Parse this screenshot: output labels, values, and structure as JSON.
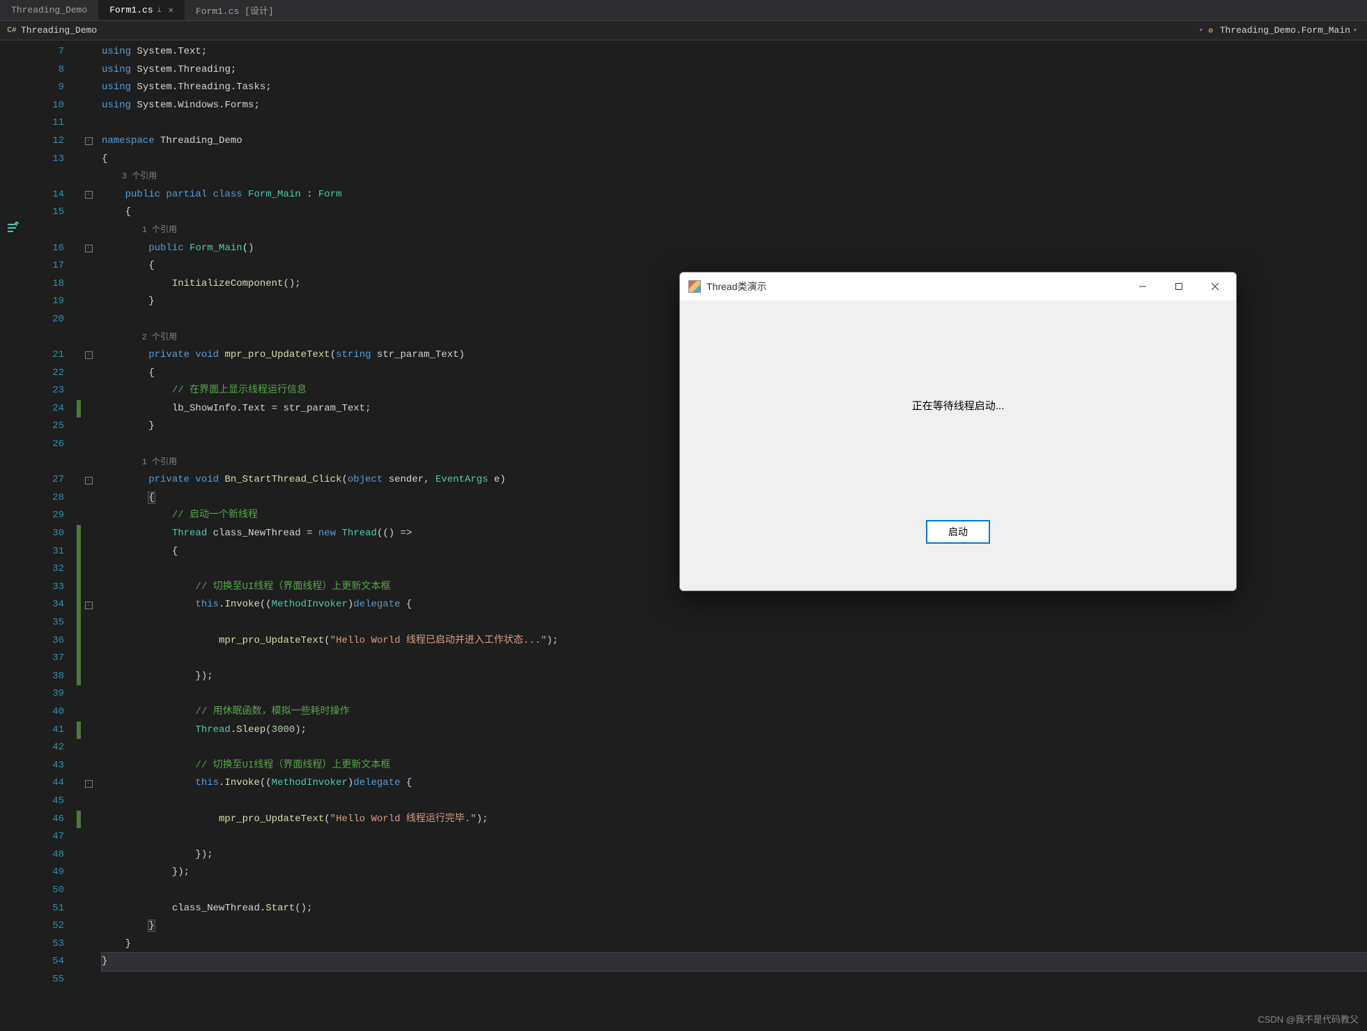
{
  "tabs": [
    {
      "label": "Threading_Demo",
      "active": false,
      "pinned": false,
      "closable": false
    },
    {
      "label": "Form1.cs",
      "active": true,
      "pinned": true,
      "closable": true
    },
    {
      "label": "Form1.cs [设计]",
      "active": false,
      "pinned": false,
      "closable": false
    }
  ],
  "breadcrumb": {
    "left_icon": "csharp-module-icon",
    "left": "Threading_Demo",
    "right_icon": "method-icon",
    "right": "Threading_Demo.Form_Main"
  },
  "line_numbers": [
    7,
    8,
    9,
    10,
    11,
    12,
    13,
    null,
    14,
    15,
    null,
    16,
    17,
    18,
    19,
    20,
    null,
    21,
    22,
    23,
    24,
    25,
    26,
    null,
    27,
    28,
    29,
    30,
    31,
    32,
    33,
    34,
    35,
    36,
    37,
    38,
    39,
    40,
    41,
    42,
    43,
    44,
    45,
    46,
    47,
    48,
    49,
    50,
    51,
    52,
    53,
    54,
    55
  ],
  "fold_markers": {
    "12": "-",
    "14": "-",
    "16": "-",
    "21": "-",
    "27": "-",
    "34": "-",
    "44": "-"
  },
  "change_markers": [
    24,
    30,
    31,
    32,
    33,
    34,
    35,
    36,
    37,
    38,
    41,
    46
  ],
  "highlighted_line_index": 51,
  "codelens": {
    "form_main_class": "3 个引用",
    "form_main_ctor": "1 个引用",
    "updatetext": "2 个引用",
    "startthread": "1 个引用"
  },
  "code": {
    "l7": {
      "kw": "using",
      "ns": "System.Text;"
    },
    "l8": {
      "kw": "using",
      "ns": "System.Threading;"
    },
    "l9": {
      "kw": "using",
      "ns": "System.Threading.Tasks;"
    },
    "l10": {
      "kw": "using",
      "ns": "System.Windows.Forms;"
    },
    "l12": {
      "kw": "namespace",
      "name": "Threading_Demo"
    },
    "l13": "{",
    "l14": {
      "mods": "public partial class",
      "name": "Form_Main",
      "colon": ":",
      "base": "Form"
    },
    "l15": "{",
    "l16": {
      "mods": "public",
      "name": "Form_Main",
      "parens": "()"
    },
    "l17": "{",
    "l18": {
      "call": "InitializeComponent",
      "after": "();"
    },
    "l19": "}",
    "l21": {
      "mods": "private void",
      "name": "mpr_pro_UpdateText",
      "open": "(",
      "ptype": "string",
      "pname": "str_param_Text",
      "close": ")"
    },
    "l22": "{",
    "l23": "// 在界面上显示线程运行信息",
    "l24": {
      "lhs": "lb_ShowInfo.Text",
      "op": "=",
      "rhs": "str_param_Text",
      "end": ";"
    },
    "l25": "}",
    "l27": {
      "mods": "private void",
      "name": "Bn_StartThread_Click",
      "open": "(",
      "p1t": "object",
      "p1n": "sender",
      "comma": ", ",
      "p2t": "EventArgs",
      "p2n": "e",
      "close": ")"
    },
    "l28": "{",
    "l29": "// 启动一个新线程",
    "l30": {
      "type": "Thread",
      "var": "class_NewThread",
      "op": "=",
      "kw_new": "new",
      "ctor": "Thread",
      "lambda": "(() =>"
    },
    "l31": "{",
    "l33": "// 切换至UI线程（界面线程）上更新文本框",
    "l34": {
      "kw_this": "this",
      "dot": ".",
      "invoke": "Invoke",
      "open": "((",
      "cast": "MethodInvoker",
      "close_cast": ")",
      "kw_delegate": "delegate",
      "brace": " {"
    },
    "l36": {
      "call": "mpr_pro_UpdateText",
      "open": "(",
      "str": "\"Hello World 线程已启动并进入工作状态...\"",
      "close": ");"
    },
    "l38": "});",
    "l40": "// 用休眠函数，模拟一些耗时操作",
    "l41": {
      "cls": "Thread",
      "dot": ".",
      "method": "Sleep",
      "open": "(",
      "num": "3000",
      "close": ");"
    },
    "l43": "// 切换至UI线程（界面线程）上更新文本框",
    "l44": {
      "kw_this": "this",
      "dot": ".",
      "invoke": "Invoke",
      "open": "((",
      "cast": "MethodInvoker",
      "close_cast": ")",
      "kw_delegate": "delegate",
      "brace": " {"
    },
    "l46": {
      "call": "mpr_pro_UpdateText",
      "open": "(",
      "str": "\"Hello World 线程运行完毕.\"",
      "close": ");"
    },
    "l48": "});",
    "l49": "});",
    "l51": {
      "var": "class_NewThread",
      "dot": ".",
      "method": "Start",
      "after": "();"
    },
    "l52": "}",
    "l53": "}",
    "l54": "}"
  },
  "dialog": {
    "title": "Thread类演示",
    "message": "正在等待线程启动...",
    "button": "启动"
  },
  "watermark": "CSDN @我不是代码教父"
}
